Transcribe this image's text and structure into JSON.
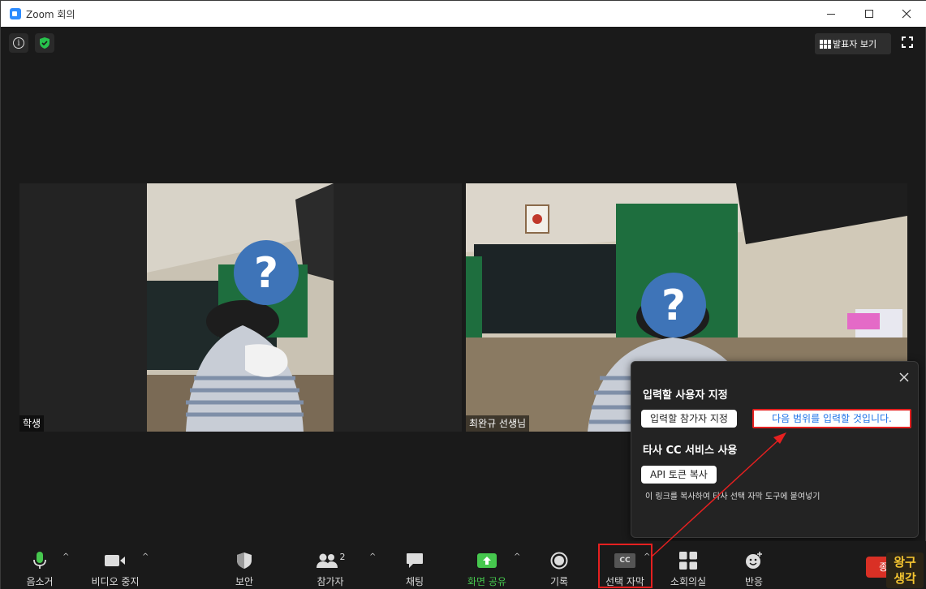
{
  "window": {
    "title": "Zoom 회의"
  },
  "top_bar": {
    "speaker_view_label": "발표자 보기"
  },
  "participants": [
    {
      "name": "학생"
    },
    {
      "name": "최완규 선생님"
    }
  ],
  "popup": {
    "heading_assign": "입력할 사용자 지정",
    "assign_button": "입력할 참가자 지정",
    "link_text": "다음 범위를 입력할 것입니다.",
    "heading_third_party": "타사 CC 서비스 사용",
    "api_button": "API 토큰 복사",
    "hint": "이 링크를 복사하여 타사 선택 자막 도구에 붙여넣기"
  },
  "toolbar": {
    "mute": "음소거",
    "video": "비디오 중지",
    "security": "보안",
    "participants": "참가자",
    "participants_count": "2",
    "chat": "채팅",
    "share": "화면 공유",
    "record": "기록",
    "captions": "선택 자막",
    "captions_badge": "CC",
    "breakout": "소회의실",
    "reactions": "반응",
    "end": "종료"
  },
  "watermark": {
    "line1": "왕구",
    "line2": "생각"
  },
  "colors": {
    "accent_green": "#46c74e",
    "highlight_red": "#e52020",
    "link_blue": "#1e73e8",
    "end_red": "#d93025"
  }
}
